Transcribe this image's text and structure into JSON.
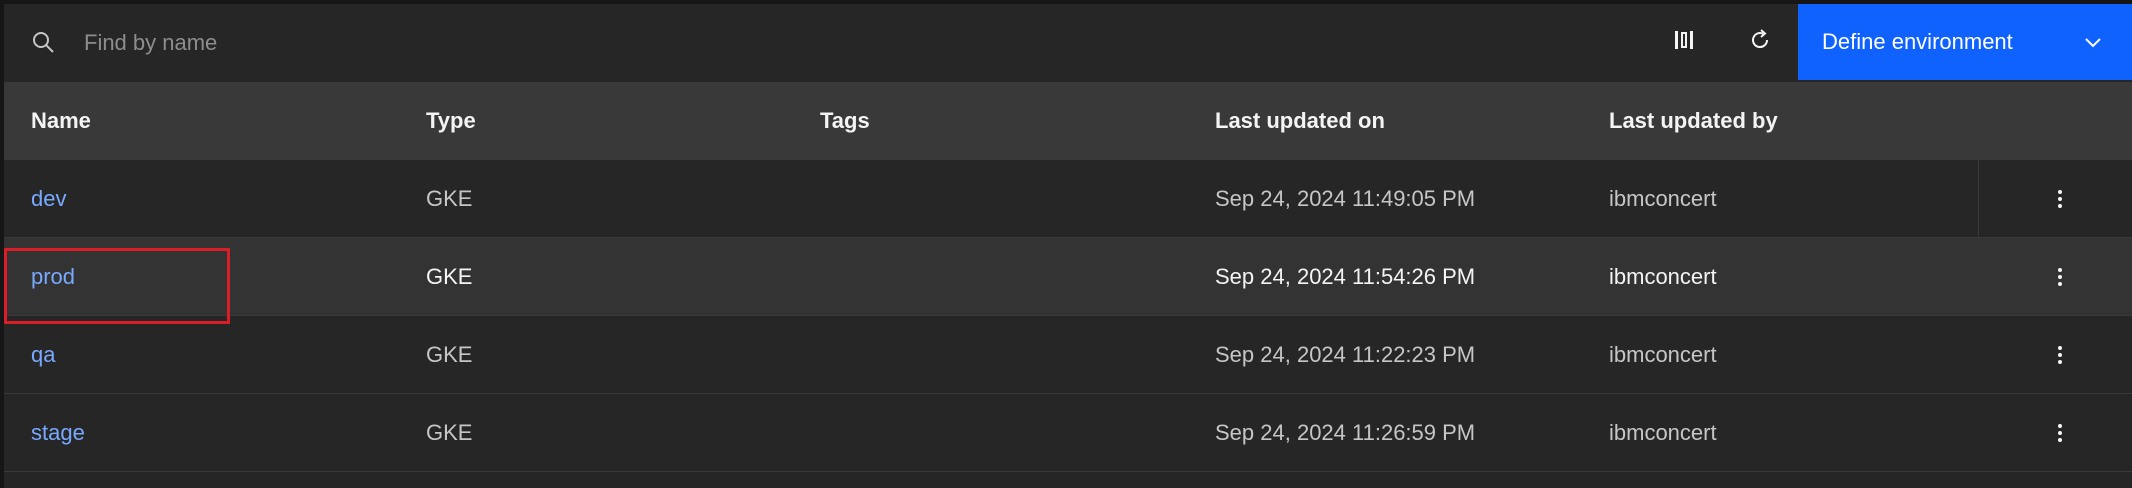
{
  "search": {
    "placeholder": "Find by name",
    "value": ""
  },
  "toolbar": {
    "columns_icon": "column-settings-icon",
    "refresh_icon": "refresh-icon",
    "primary_label": "Define environment",
    "primary_chevron_icon": "chevron-down-icon",
    "primary_color": "#0f62fe"
  },
  "table": {
    "headers": {
      "name": "Name",
      "type": "Type",
      "tags": "Tags",
      "updated_on": "Last updated on",
      "updated_by": "Last updated by"
    },
    "rows": [
      {
        "name": "dev",
        "type": "GKE",
        "tags": "",
        "updated_on": "Sep 24, 2024 11:49:05 PM",
        "updated_by": "ibmconcert"
      },
      {
        "name": "prod",
        "type": "GKE",
        "tags": "",
        "updated_on": "Sep 24, 2024 11:54:26 PM",
        "updated_by": "ibmconcert"
      },
      {
        "name": "qa",
        "type": "GKE",
        "tags": "",
        "updated_on": "Sep 24, 2024 11:22:23 PM",
        "updated_by": "ibmconcert"
      },
      {
        "name": "stage",
        "type": "GKE",
        "tags": "",
        "updated_on": "Sep 24, 2024 11:26:59 PM",
        "updated_by": "ibmconcert"
      }
    ],
    "overflow_icon": "overflow-menu-vertical-icon"
  },
  "colors": {
    "link": "#78a9ff",
    "highlight": "#da1e28",
    "header_bg": "#393939",
    "row_bg": "#262626"
  }
}
